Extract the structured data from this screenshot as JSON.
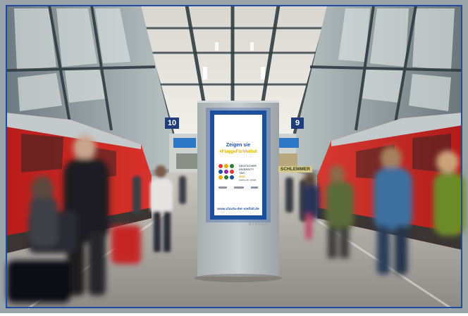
{
  "platform": {
    "track_left": "10",
    "track_right": "9",
    "shop_sign": "SCHLEMMER"
  },
  "billboard": {
    "headline_line1": "Zeigen sie",
    "headline_line2": "#FlaggeFürVielfalt",
    "logo_line1": "DEUTSCHER",
    "logo_line2": "DIVERSITY",
    "logo_line3": "TAG",
    "logo_year": "2021",
    "logo_sub": "charta der vielfalt",
    "url": "www.charta-der-vielfalt.de",
    "frame_brand": "STRÖER"
  },
  "colors": {
    "frame_blue": "#1d4f9f",
    "train_red": "#c8201e",
    "hall_steel": "#8f9aa0",
    "accent_yellow": "#e8b000"
  }
}
